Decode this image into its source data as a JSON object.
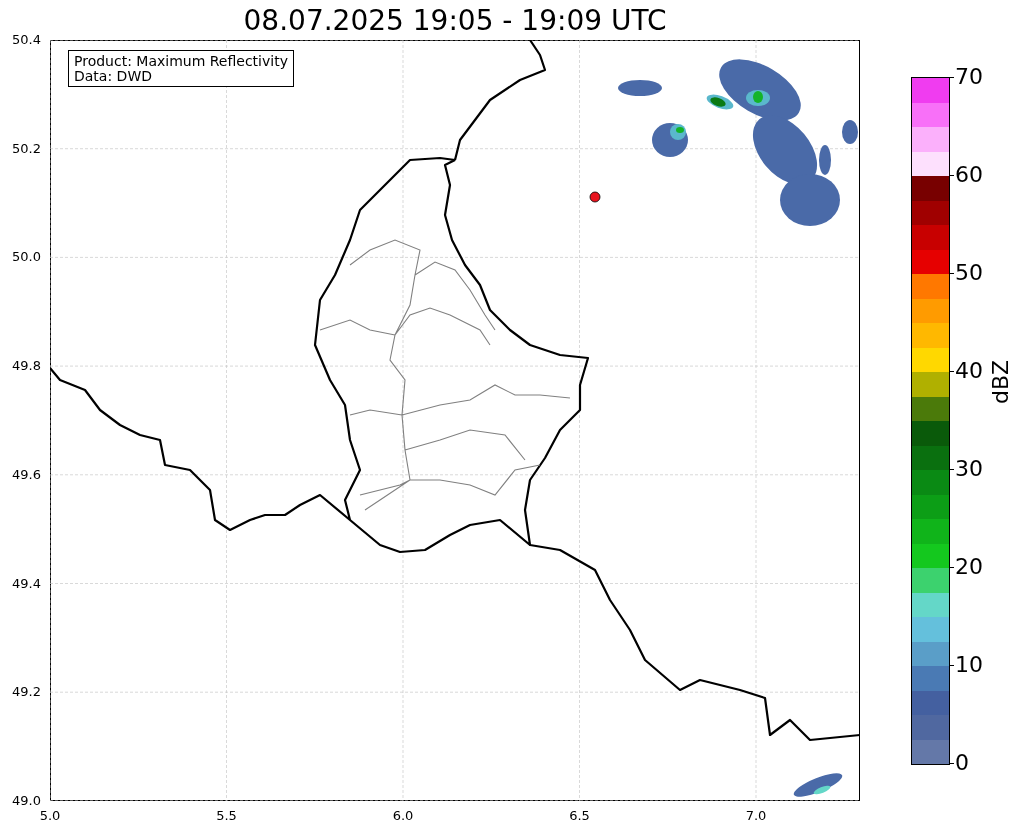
{
  "title": "08.07.2025 19:05 - 19:09 UTC",
  "info_box": {
    "lines": [
      "Product: Maximum Reflectivity",
      "Data: DWD"
    ]
  },
  "map": {
    "x_ticks": [
      "5.0",
      "5.5",
      "6.0",
      "6.5",
      "7.0"
    ],
    "y_ticks": [
      "50.4",
      "50.2",
      "50.0",
      "49.8",
      "49.6",
      "49.4",
      "49.2",
      "49.0"
    ]
  },
  "colorbar": {
    "label": "dBZ",
    "ticks": [
      "70",
      "60",
      "50",
      "40",
      "30",
      "20",
      "10",
      "0"
    ],
    "bins": [
      {
        "color": "#6478a8"
      },
      {
        "color": "#5068a0"
      },
      {
        "color": "#4460a0"
      },
      {
        "color": "#4a7ab4"
      },
      {
        "color": "#5a9ec8"
      },
      {
        "color": "#64c0dc"
      },
      {
        "color": "#64d7c8"
      },
      {
        "color": "#3cd26e"
      },
      {
        "color": "#14c81e"
      },
      {
        "color": "#10b41a"
      },
      {
        "color": "#0c9e16"
      },
      {
        "color": "#0a8a14"
      },
      {
        "color": "#0a700f"
      },
      {
        "color": "#0a5a0a"
      },
      {
        "color": "#4b7a0a"
      },
      {
        "color": "#b0b000"
      },
      {
        "color": "#ffd800"
      },
      {
        "color": "#ffb800"
      },
      {
        "color": "#ff9b00"
      },
      {
        "color": "#ff7800"
      },
      {
        "color": "#e60000"
      },
      {
        "color": "#c80000"
      },
      {
        "color": "#a00000"
      },
      {
        "color": "#780000"
      },
      {
        "color": "#fde0fd"
      },
      {
        "color": "#fbb0fb"
      },
      {
        "color": "#f870f8"
      },
      {
        "color": "#f03cf0"
      }
    ]
  }
}
